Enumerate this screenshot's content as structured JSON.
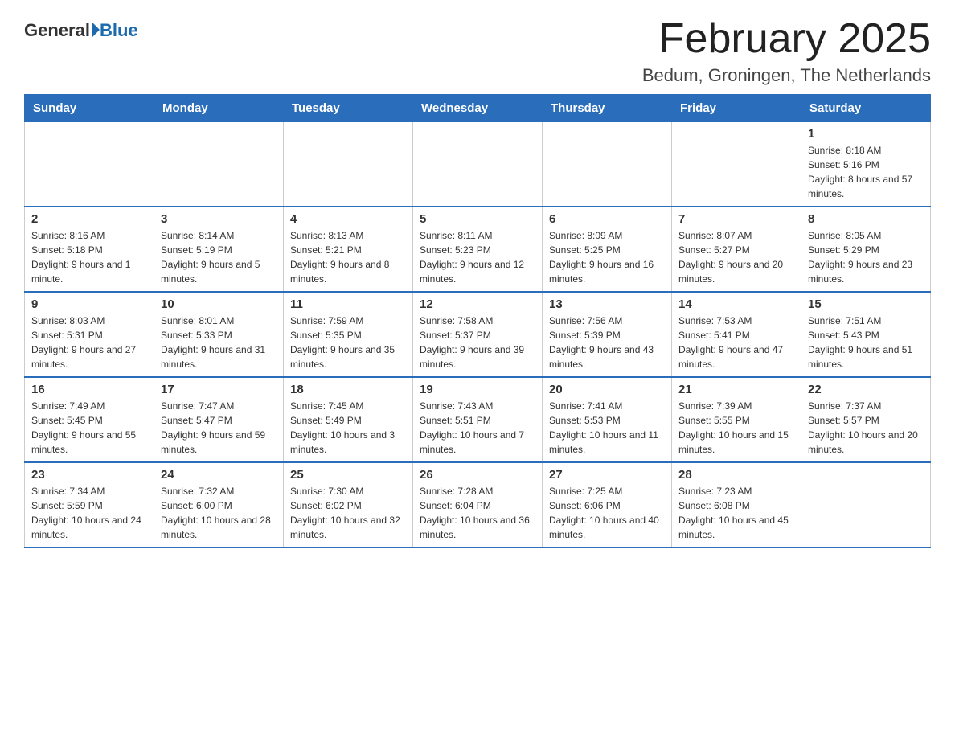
{
  "header": {
    "logo": {
      "general": "General",
      "blue": "Blue"
    },
    "title": "February 2025",
    "location": "Bedum, Groningen, The Netherlands"
  },
  "weekdays": [
    "Sunday",
    "Monday",
    "Tuesday",
    "Wednesday",
    "Thursday",
    "Friday",
    "Saturday"
  ],
  "weeks": [
    [
      {
        "day": "",
        "info": ""
      },
      {
        "day": "",
        "info": ""
      },
      {
        "day": "",
        "info": ""
      },
      {
        "day": "",
        "info": ""
      },
      {
        "day": "",
        "info": ""
      },
      {
        "day": "",
        "info": ""
      },
      {
        "day": "1",
        "info": "Sunrise: 8:18 AM\nSunset: 5:16 PM\nDaylight: 8 hours and 57 minutes."
      }
    ],
    [
      {
        "day": "2",
        "info": "Sunrise: 8:16 AM\nSunset: 5:18 PM\nDaylight: 9 hours and 1 minute."
      },
      {
        "day": "3",
        "info": "Sunrise: 8:14 AM\nSunset: 5:19 PM\nDaylight: 9 hours and 5 minutes."
      },
      {
        "day": "4",
        "info": "Sunrise: 8:13 AM\nSunset: 5:21 PM\nDaylight: 9 hours and 8 minutes."
      },
      {
        "day": "5",
        "info": "Sunrise: 8:11 AM\nSunset: 5:23 PM\nDaylight: 9 hours and 12 minutes."
      },
      {
        "day": "6",
        "info": "Sunrise: 8:09 AM\nSunset: 5:25 PM\nDaylight: 9 hours and 16 minutes."
      },
      {
        "day": "7",
        "info": "Sunrise: 8:07 AM\nSunset: 5:27 PM\nDaylight: 9 hours and 20 minutes."
      },
      {
        "day": "8",
        "info": "Sunrise: 8:05 AM\nSunset: 5:29 PM\nDaylight: 9 hours and 23 minutes."
      }
    ],
    [
      {
        "day": "9",
        "info": "Sunrise: 8:03 AM\nSunset: 5:31 PM\nDaylight: 9 hours and 27 minutes."
      },
      {
        "day": "10",
        "info": "Sunrise: 8:01 AM\nSunset: 5:33 PM\nDaylight: 9 hours and 31 minutes."
      },
      {
        "day": "11",
        "info": "Sunrise: 7:59 AM\nSunset: 5:35 PM\nDaylight: 9 hours and 35 minutes."
      },
      {
        "day": "12",
        "info": "Sunrise: 7:58 AM\nSunset: 5:37 PM\nDaylight: 9 hours and 39 minutes."
      },
      {
        "day": "13",
        "info": "Sunrise: 7:56 AM\nSunset: 5:39 PM\nDaylight: 9 hours and 43 minutes."
      },
      {
        "day": "14",
        "info": "Sunrise: 7:53 AM\nSunset: 5:41 PM\nDaylight: 9 hours and 47 minutes."
      },
      {
        "day": "15",
        "info": "Sunrise: 7:51 AM\nSunset: 5:43 PM\nDaylight: 9 hours and 51 minutes."
      }
    ],
    [
      {
        "day": "16",
        "info": "Sunrise: 7:49 AM\nSunset: 5:45 PM\nDaylight: 9 hours and 55 minutes."
      },
      {
        "day": "17",
        "info": "Sunrise: 7:47 AM\nSunset: 5:47 PM\nDaylight: 9 hours and 59 minutes."
      },
      {
        "day": "18",
        "info": "Sunrise: 7:45 AM\nSunset: 5:49 PM\nDaylight: 10 hours and 3 minutes."
      },
      {
        "day": "19",
        "info": "Sunrise: 7:43 AM\nSunset: 5:51 PM\nDaylight: 10 hours and 7 minutes."
      },
      {
        "day": "20",
        "info": "Sunrise: 7:41 AM\nSunset: 5:53 PM\nDaylight: 10 hours and 11 minutes."
      },
      {
        "day": "21",
        "info": "Sunrise: 7:39 AM\nSunset: 5:55 PM\nDaylight: 10 hours and 15 minutes."
      },
      {
        "day": "22",
        "info": "Sunrise: 7:37 AM\nSunset: 5:57 PM\nDaylight: 10 hours and 20 minutes."
      }
    ],
    [
      {
        "day": "23",
        "info": "Sunrise: 7:34 AM\nSunset: 5:59 PM\nDaylight: 10 hours and 24 minutes."
      },
      {
        "day": "24",
        "info": "Sunrise: 7:32 AM\nSunset: 6:00 PM\nDaylight: 10 hours and 28 minutes."
      },
      {
        "day": "25",
        "info": "Sunrise: 7:30 AM\nSunset: 6:02 PM\nDaylight: 10 hours and 32 minutes."
      },
      {
        "day": "26",
        "info": "Sunrise: 7:28 AM\nSunset: 6:04 PM\nDaylight: 10 hours and 36 minutes."
      },
      {
        "day": "27",
        "info": "Sunrise: 7:25 AM\nSunset: 6:06 PM\nDaylight: 10 hours and 40 minutes."
      },
      {
        "day": "28",
        "info": "Sunrise: 7:23 AM\nSunset: 6:08 PM\nDaylight: 10 hours and 45 minutes."
      },
      {
        "day": "",
        "info": ""
      }
    ]
  ]
}
